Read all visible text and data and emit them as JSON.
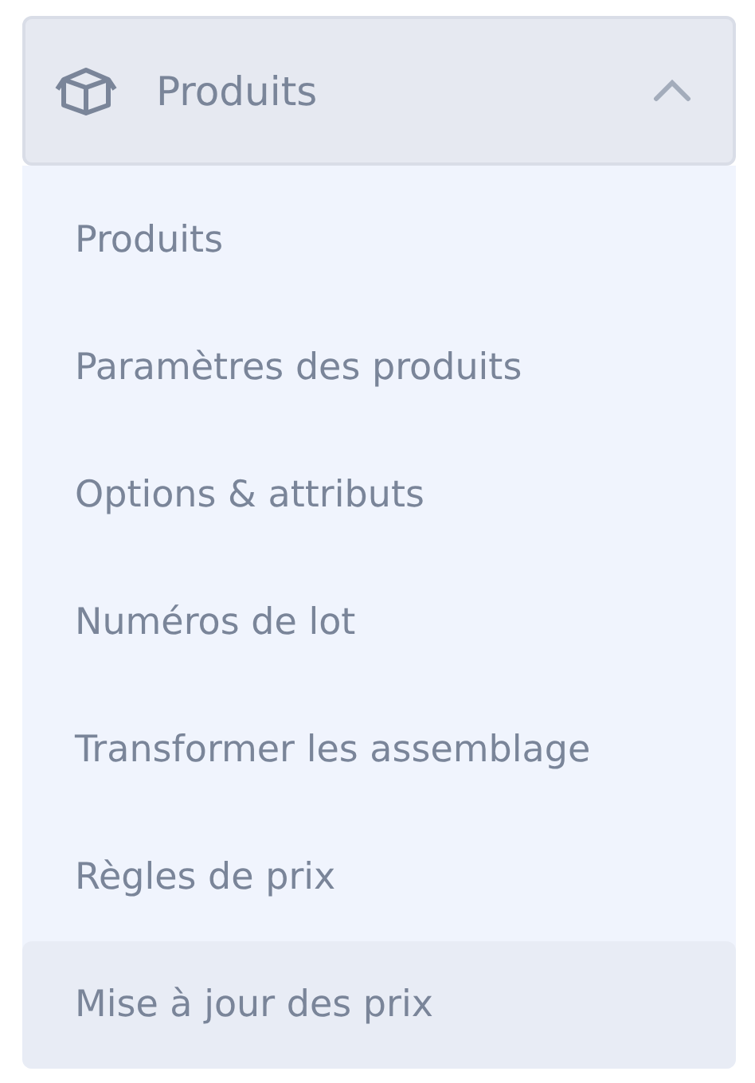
{
  "section": {
    "title": "Produits",
    "expanded": true
  },
  "items": [
    {
      "label": "Produits",
      "selected": false
    },
    {
      "label": "Paramètres des produits",
      "selected": false
    },
    {
      "label": "Options & attributs",
      "selected": false
    },
    {
      "label": "Numéros de lot",
      "selected": false
    },
    {
      "label": "Transformer les assemblage",
      "selected": false
    },
    {
      "label": "Règles de prix",
      "selected": false
    },
    {
      "label": "Mise à jour des prix",
      "selected": true
    }
  ]
}
